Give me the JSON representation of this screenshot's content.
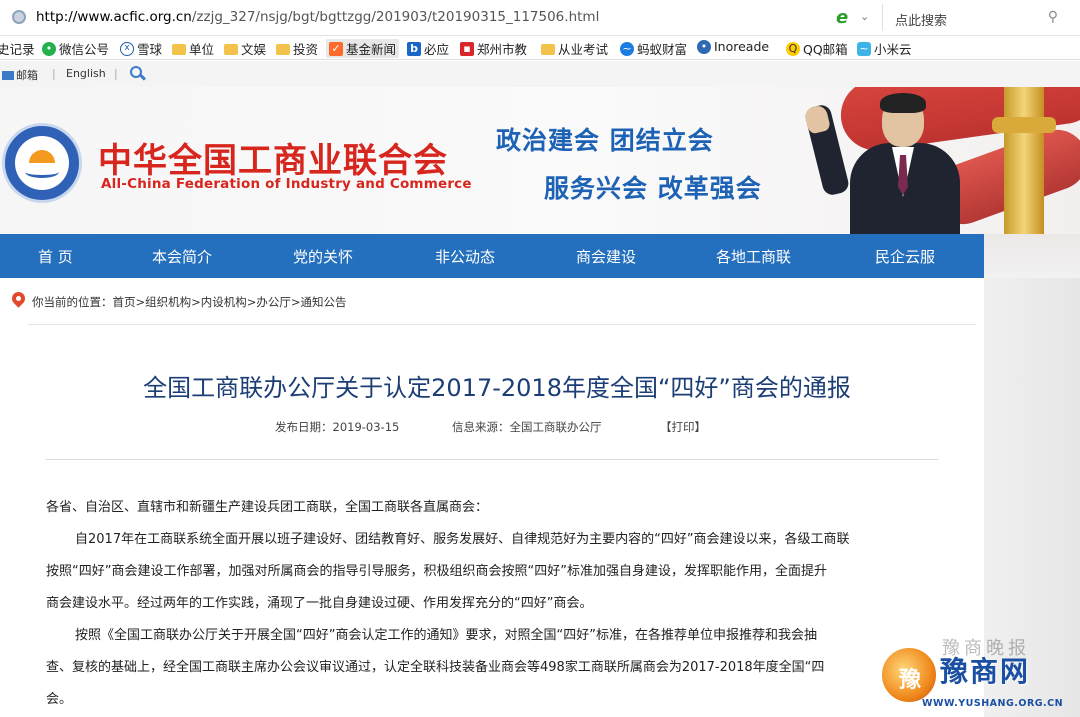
{
  "browser": {
    "url_domain": "http://www.acfic.org.cn",
    "url_path": "/zzjg_327/nsjg/bgt/bgttzgg/201903/t20190315_117506.html",
    "search_placeholder": "点此搜索",
    "bookmarks": [
      {
        "label": "史记录",
        "icon": "history-icon"
      },
      {
        "label": "微信公号",
        "icon": "wechat-icon"
      },
      {
        "label": "雪球",
        "icon": "snowball-icon"
      },
      {
        "label": "单位",
        "icon": "folder-icon"
      },
      {
        "label": "文娱",
        "icon": "folder-icon"
      },
      {
        "label": "投资",
        "icon": "folder-icon"
      },
      {
        "label": "基金新闻",
        "icon": "fund-icon"
      },
      {
        "label": "必应",
        "icon": "bing-icon"
      },
      {
        "label": "郑州市教",
        "icon": "news-icon"
      },
      {
        "label": "从业考试",
        "icon": "folder-icon"
      },
      {
        "label": "蚂蚁财富",
        "icon": "ant-icon"
      },
      {
        "label": "Inoreade",
        "icon": "inoreader-icon"
      },
      {
        "label": "QQ邮箱",
        "icon": "qqmail-icon"
      },
      {
        "label": "小米云",
        "icon": "micloud-icon"
      }
    ]
  },
  "site": {
    "top_links": {
      "mail": "邮箱",
      "sep": "|",
      "english": "English"
    },
    "org_name_cn": "中华全国工商业联合会",
    "org_name_en": "All-China Federation of Industry and Commerce",
    "slogan_line1": "政治建会  团结立会",
    "slogan_line2": "服务兴会  改革强会",
    "nav": [
      "首 页",
      "本会简介",
      "党的关怀",
      "非公动态",
      "商会建设",
      "各地工商联",
      "民企云服"
    ],
    "breadcrumb": "你当前的位置：首页>组织机构>内设机构>办公厅>通知公告"
  },
  "article": {
    "title": "全国工商联办公厅关于认定2017-2018年度全国“四好”商会的通报",
    "publish_date": "发布日期：2019-03-15",
    "source": "信息来源：全国工商联办公厅",
    "print": "【打印】",
    "paragraphs": [
      "各省、自治区、直辖市和新疆生产建设兵团工商联，全国工商联各直属商会：",
      "自2017年在工商联系统全面开展以班子建设好、团结教育好、服务发展好、自律规范好为主要内容的“四好”商会建设以来，各级工商联",
      "按照“四好”商会建设工作部署，加强对所属商会的指导引导服务，积极组织商会按照“四好”标准加强自身建设，发挥职能作用，全面提升",
      "商会建设水平。经过两年的工作实践，涌现了一批自身建设过硬、作用发挥充分的“四好”商会。",
      "按照《全国工商联办公厅关于开展全国“四好”商会认定工作的通知》要求，对照全国“四好”标准，在各推荐单位申报推荐和我会抽",
      "查、复核的基础上，经全国工商联主席办公会议审议通过，认定全联科技装备业商会等498家工商联所属商会为2017-2018年度全国“四",
      "会。"
    ]
  },
  "watermark": {
    "badge": "豫",
    "text": "豫商网",
    "ghost": "豫商晚报",
    "url": "WWW.YUSHANG.ORG.CN"
  }
}
